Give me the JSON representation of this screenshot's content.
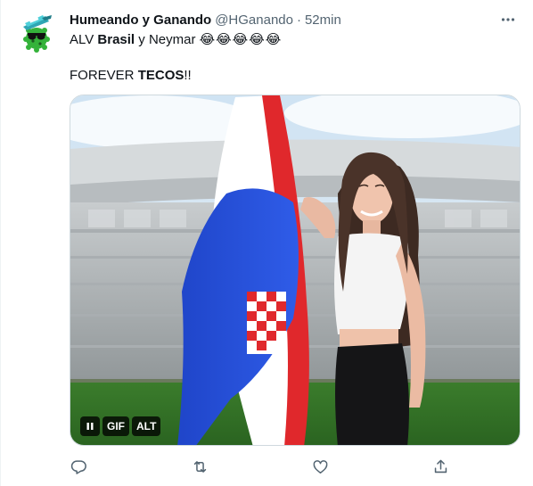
{
  "tweet": {
    "display_name": "Humeando y Ganando",
    "handle": "@HGanando",
    "separator": "·",
    "time": "52min",
    "text_line1": {
      "prefix": "ALV ",
      "bold": "Brasil",
      "suffix": " y Neymar ",
      "emojis": "😂😂😂😂😂"
    },
    "text_line2": {
      "prefix": "FOREVER ",
      "bold": "TECOS",
      "suffix": "!!"
    }
  },
  "media": {
    "type": "gif",
    "pause_label": "❚❚",
    "gif_label": "GIF",
    "alt_label": "ALT"
  },
  "icons": {
    "more": "more-icon",
    "reply": "reply-icon",
    "retweet": "retweet-icon",
    "like": "like-icon",
    "share": "share-icon"
  },
  "colors": {
    "text": "#0f1419",
    "secondary": "#536471",
    "avatar_green": "#3fbf3f"
  }
}
